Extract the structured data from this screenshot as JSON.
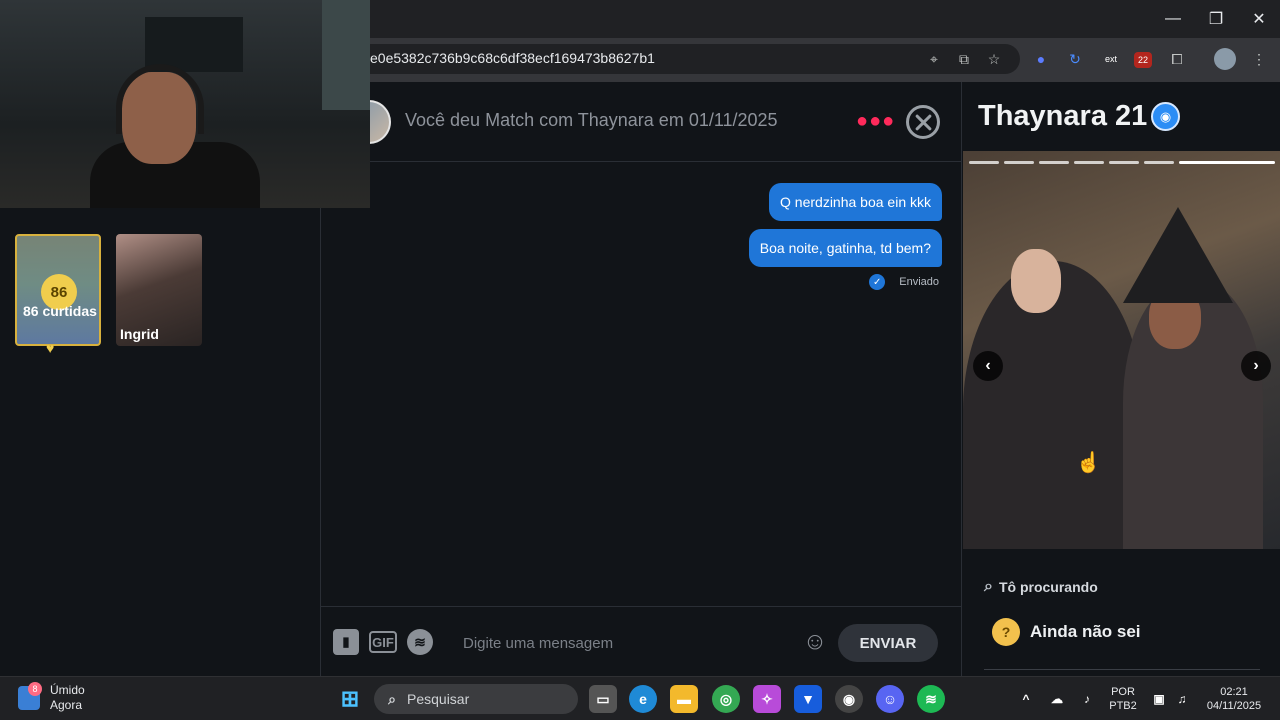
{
  "browser": {
    "url": "e0e5382c736b9c68c6df38ecf169473b8627b1",
    "extension_ext_label": "ext",
    "extension_badge_count": "22"
  },
  "left_panel": {
    "likes_count": "86",
    "likes_label": "86 curtidas",
    "match_name": "Ingrid"
  },
  "chat": {
    "header_text": "Você deu Match com Thaynara em 01/11/2025",
    "messages": [
      {
        "text": "Q nerdzinha boa ein kkk",
        "sender": "me"
      },
      {
        "text": "Boa noite, gatinha, td bem?",
        "sender": "me"
      }
    ],
    "sent_status": "Enviado",
    "composer_placeholder": "Digite uma mensagem",
    "gif_label": "GIF",
    "send_label": "ENVIAR"
  },
  "profile": {
    "name_age": "Thaynara 21",
    "looking_for_label": "Tô procurando",
    "looking_for_value": "Ainda não sei",
    "photo_count": 7,
    "current_photo": 7
  },
  "taskbar": {
    "weather_label": "Úmido",
    "weather_sub": "Agora",
    "weather_badge": "8",
    "search_placeholder": "Pesquisar",
    "lang_top": "POR",
    "lang_bottom": "PTB2",
    "time": "02:21",
    "date": "04/11/2025"
  },
  "colors": {
    "accent_blue": "#1f76d8",
    "tinder_red": "#ff2a5b",
    "gold": "#d8b13d"
  }
}
